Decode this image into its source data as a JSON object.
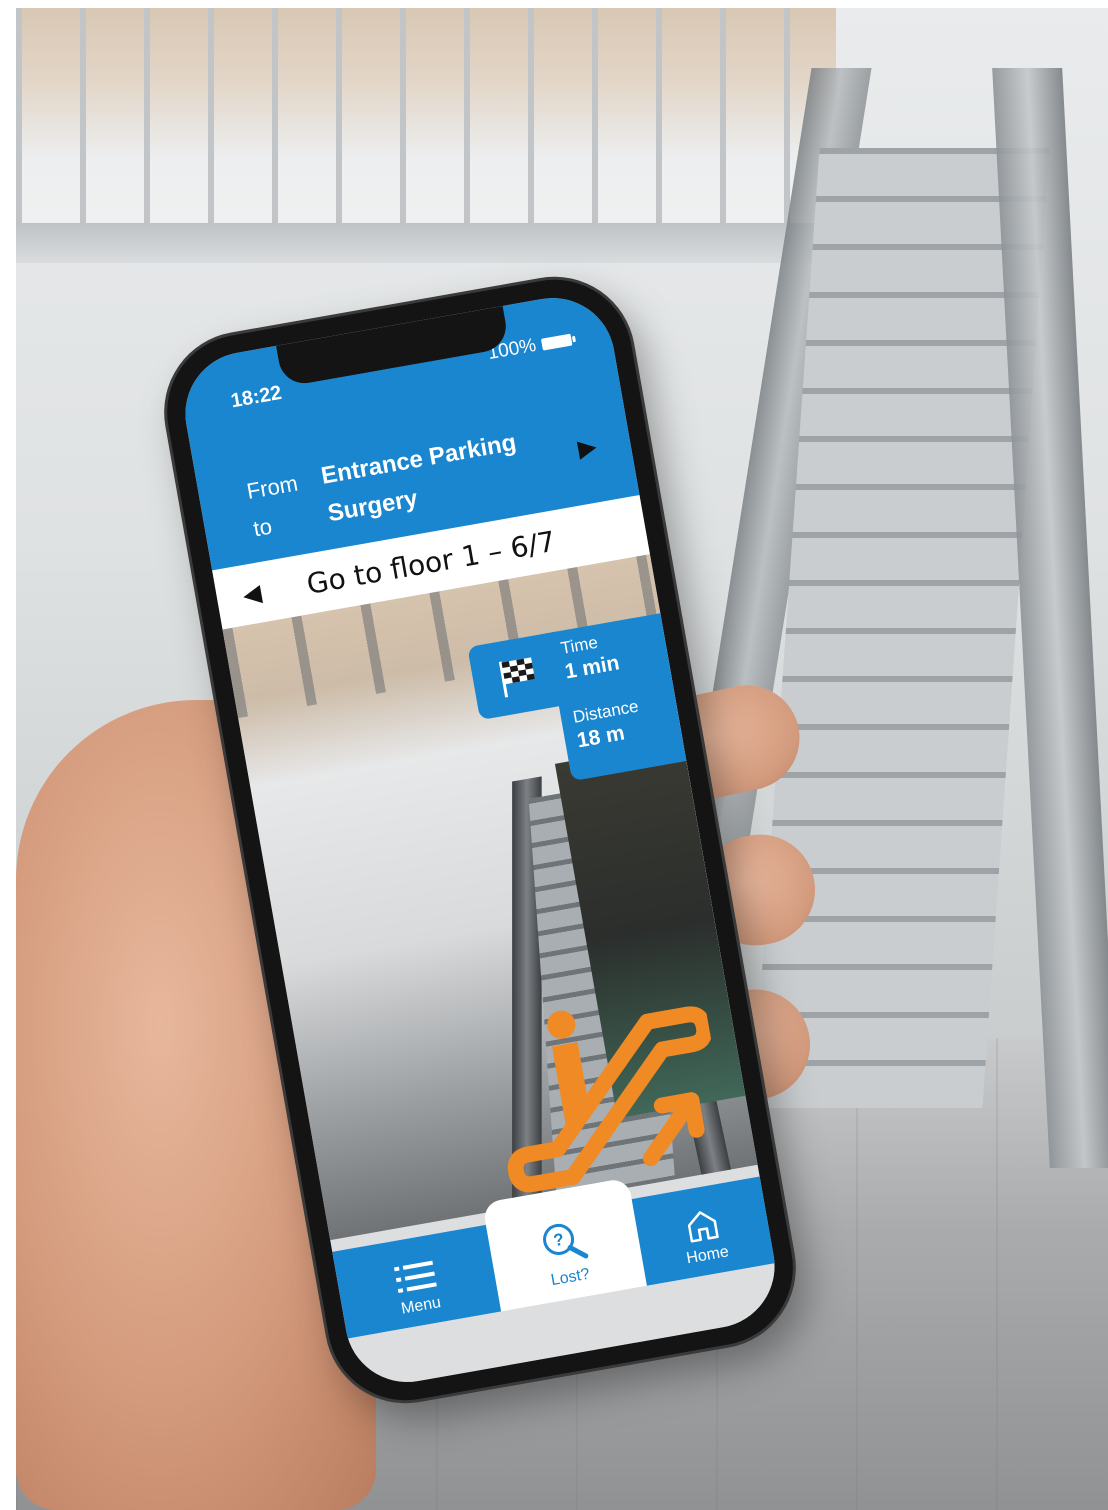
{
  "status_bar": {
    "time": "18:22",
    "battery": "100%"
  },
  "route": {
    "from_label": "From",
    "to_label": "to",
    "from_value": "Entrance Parking",
    "to_value": "Surgery"
  },
  "instruction": {
    "text": "Go to floor 1 – 6/7"
  },
  "info": {
    "time_label": "Time",
    "time_value": "1 min",
    "distance_label": "Distance",
    "distance_value": "18 m"
  },
  "nav": {
    "menu_label": "Menu",
    "lost_label": "Lost?",
    "home_label": "Home"
  },
  "icons": {
    "next": "play-right-icon",
    "prev": "play-left-icon",
    "flag": "checkered-flag-icon",
    "escalator": "escalator-up-icon",
    "menu": "menu-lines-icon",
    "lost": "question-magnifier-icon",
    "home": "house-icon",
    "battery": "battery-icon"
  },
  "colors": {
    "brand_blue": "#1a86cf",
    "escalator_orange": "#f08a24",
    "screen_bg": "#dcdedf"
  }
}
